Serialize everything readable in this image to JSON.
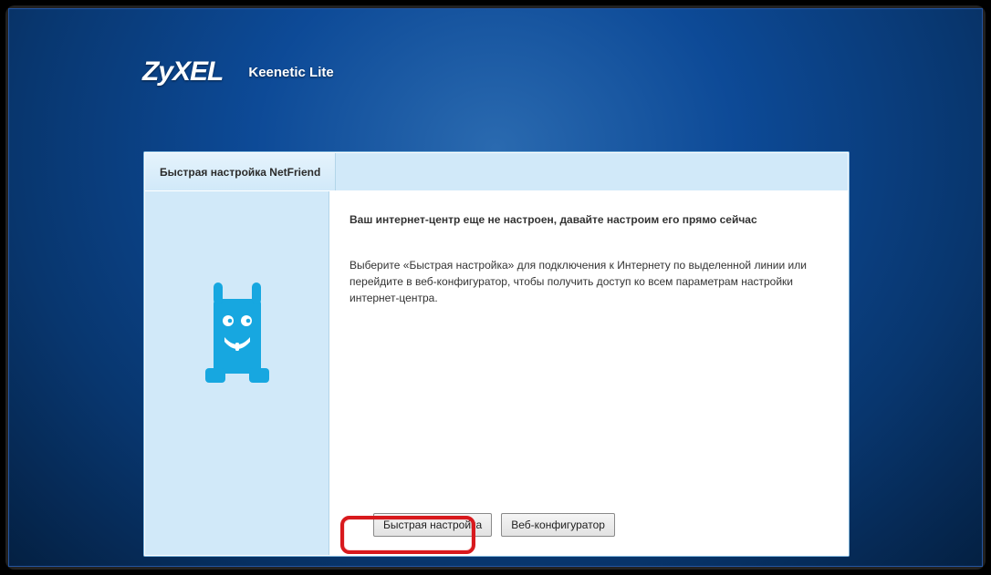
{
  "brand": {
    "logo_text": "ZyXEL",
    "product_name": "Keenetic Lite"
  },
  "panel": {
    "tab_label": "Быстрая настройка NetFriend",
    "heading": "Ваш интернет-центр еще не настроен, давайте настроим его прямо сейчас",
    "description": "Выберите «Быстрая настройка» для подключения к Интернету по выделенной линии или перейдите в веб-конфигуратор, чтобы получить доступ ко всем параметрам настройки интернет-центра."
  },
  "buttons": {
    "quick": "Быстрая настройка",
    "webconfig": "Веб-конфигуратор"
  },
  "icons": {
    "mascot": "netfriend-mascot"
  }
}
